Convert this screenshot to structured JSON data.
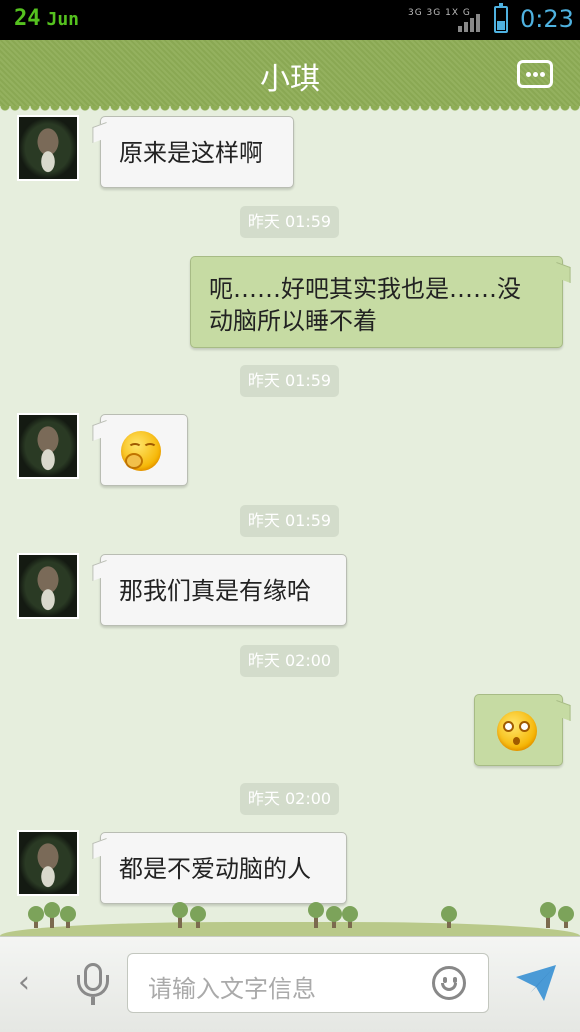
{
  "status_bar": {
    "day": "24",
    "month": "Jun",
    "signal_text": "3G 3G 1X G",
    "time": "0:23"
  },
  "header": {
    "title": "小琪",
    "more_icon": "more-dots-icon"
  },
  "messages": [
    {
      "side": "left",
      "type": "text",
      "text": "原来是这样啊"
    },
    {
      "type": "timestamp",
      "text": "昨天 01:59"
    },
    {
      "side": "right",
      "type": "text",
      "text": "呃……好吧其实我也是……没动脑所以睡不着"
    },
    {
      "type": "timestamp",
      "text": "昨天 01:59"
    },
    {
      "side": "left",
      "type": "emoji",
      "emoji": "shy-emoji-icon"
    },
    {
      "type": "timestamp",
      "text": "昨天 01:59"
    },
    {
      "side": "left",
      "type": "text",
      "text": "那我们真是有缘哈"
    },
    {
      "type": "timestamp",
      "text": "昨天 02:00"
    },
    {
      "side": "right",
      "type": "emoji",
      "emoji": "shocked-emoji-icon"
    },
    {
      "type": "timestamp",
      "text": "昨天 02:00"
    },
    {
      "side": "left",
      "type": "text",
      "text": "都是不爱动脑的人"
    }
  ],
  "input_bar": {
    "placeholder": "请输入文字信息",
    "back_icon": "back-chevron-icon",
    "mic_icon": "microphone-icon",
    "emoji_icon": "smiley-icon",
    "send_icon": "send-icon"
  },
  "colors": {
    "header_green": "#8ead56",
    "chat_background": "#e6eedd",
    "right_bubble": "#c6dba3",
    "left_bubble": "#f6f6f6",
    "accent_blue": "#4fb2e0"
  }
}
